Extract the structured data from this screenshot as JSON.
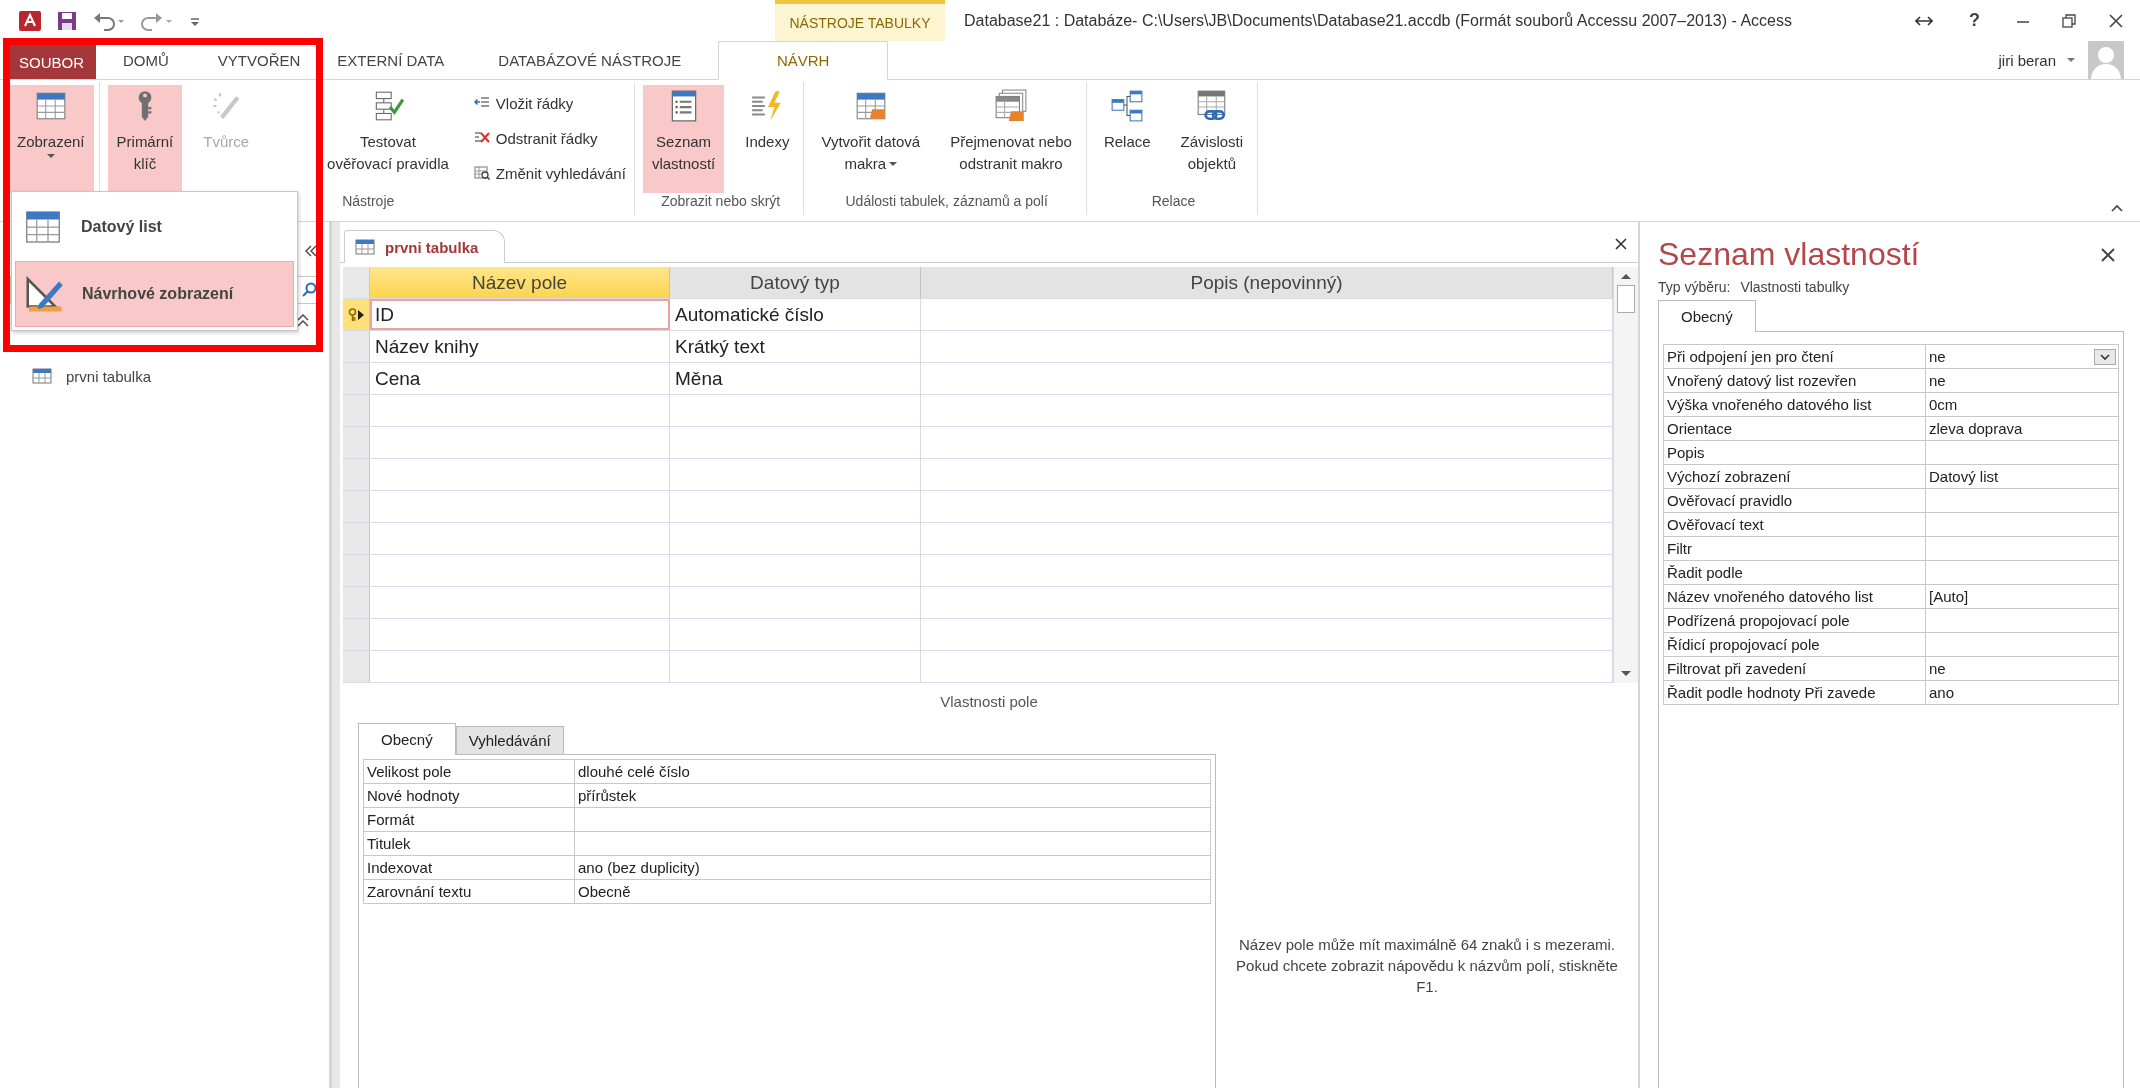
{
  "window": {
    "title": "Database21 : Databáze- C:\\Users\\JB\\Documents\\Database21.accdb (Formát souborů Accessu 2007–2013) - Access",
    "contextual_group": "NÁSTROJE TABULKY",
    "help_button": "?"
  },
  "user": {
    "name": "jiri beran"
  },
  "ribbon_tabs": [
    {
      "label": "SOUBOR",
      "kind": "file",
      "selected": false
    },
    {
      "label": "DOMŮ",
      "kind": "tab",
      "selected": false
    },
    {
      "label": "VYTVOŘEN",
      "kind": "tab",
      "selected": false
    },
    {
      "label": "EXTERNÍ DATA",
      "kind": "tab",
      "selected": false
    },
    {
      "label": "DATABÁZOVÉ NÁSTROJE",
      "kind": "tab",
      "selected": false
    },
    {
      "label": "NÁVRH",
      "kind": "tab",
      "selected": true
    }
  ],
  "ribbon_groups": [
    {
      "items": [
        {
          "kind": "large",
          "lines": [
            "Zobrazení"
          ],
          "pressed": true,
          "disabled": false,
          "dropdown": true
        }
      ]
    },
    {
      "label": "Nástroje",
      "items": [
        {
          "kind": "large",
          "lines": [
            "Primární",
            "klíč"
          ],
          "pressed": true,
          "disabled": false,
          "dropdown": false
        },
        {
          "kind": "large",
          "lines": [
            "Tvůrce"
          ],
          "pressed": false,
          "disabled": true,
          "dropdown": false
        },
        {
          "kind": "large",
          "lines": [
            "Testovat",
            "ověřovací pravidla"
          ],
          "pressed": false,
          "disabled": false,
          "dropdown": false
        },
        {
          "kind": "stack",
          "buttons": [
            {
              "label": "Vložit řádky"
            },
            {
              "label": "Odstranit řádky"
            },
            {
              "label": "Změnit vyhledávání"
            }
          ]
        }
      ]
    },
    {
      "label": "Zobrazit nebo skrýt",
      "items": [
        {
          "kind": "large",
          "lines": [
            "Seznam",
            "vlastností"
          ],
          "pressed": true,
          "disabled": false,
          "dropdown": false
        },
        {
          "kind": "large",
          "lines": [
            "Indexy"
          ],
          "pressed": false,
          "disabled": false,
          "dropdown": false
        }
      ]
    },
    {
      "label": "Události tabulek, záznamů a polí",
      "items": [
        {
          "kind": "large",
          "lines": [
            "Vytvořit datová",
            "makra"
          ],
          "pressed": false,
          "disabled": false,
          "dropdown": true
        },
        {
          "kind": "large",
          "lines": [
            "Přejmenovat nebo",
            "odstranit makro"
          ],
          "pressed": false,
          "disabled": false,
          "dropdown": false
        }
      ]
    },
    {
      "label": "Relace",
      "items": [
        {
          "kind": "large",
          "lines": [
            "Relace"
          ],
          "pressed": false,
          "disabled": false,
          "dropdown": false
        },
        {
          "kind": "large",
          "lines": [
            "Závislosti",
            "objektů"
          ],
          "pressed": false,
          "disabled": false,
          "dropdown": false
        }
      ]
    }
  ],
  "view_menu": {
    "items": [
      {
        "label": "Datový list",
        "selected": false
      },
      {
        "label": "Návrhové zobrazení",
        "selected": true
      }
    ]
  },
  "navigation_pane": {
    "items": [
      {
        "label": "prvni tabulka"
      }
    ]
  },
  "document_tab": {
    "label": "prvni tabulka"
  },
  "design_grid": {
    "columns": [
      {
        "label": "Název pole",
        "selected": true
      },
      {
        "label": "Datový typ",
        "selected": false
      },
      {
        "label": "Popis (nepovinný)",
        "selected": false
      }
    ],
    "rows": [
      {
        "name": "ID",
        "type": "Automatické číslo",
        "primary_key": true,
        "selected": true
      },
      {
        "name": "Název knihy",
        "type": "Krátký text",
        "primary_key": false,
        "selected": false
      },
      {
        "name": "Cena",
        "type": "Měna",
        "primary_key": false,
        "selected": false
      }
    ]
  },
  "field_properties": {
    "title": "Vlastnosti pole",
    "tabs": [
      {
        "label": "Obecný",
        "selected": true
      },
      {
        "label": "Vyhledávání",
        "selected": false
      }
    ],
    "rows": [
      {
        "label": "Velikost pole",
        "value": "dlouhé celé číslo"
      },
      {
        "label": "Nové hodnoty",
        "value": "přírůstek"
      },
      {
        "label": "Formát"
      },
      {
        "label": "Titulek"
      },
      {
        "label": "Indexovat",
        "value": "ano (bez duplicity)"
      },
      {
        "label": "Zarovnání textu",
        "value": "Obecně"
      }
    ],
    "help": "Název pole může mít maximálně 64 znaků i s mezerami. Pokud chcete zobrazit nápovědu k názvům polí, stiskněte F1."
  },
  "property_sheet": {
    "title": "Seznam vlastností",
    "selection_type_label": "Typ výběru:",
    "selection_type": "Vlastnosti tabulky",
    "tabs": [
      {
        "label": "Obecný",
        "selected": true
      }
    ],
    "rows": [
      {
        "label": "Při odpojení jen pro čtení",
        "value": "ne",
        "dropdown": true
      },
      {
        "label": "Vnořený datový list rozevřen",
        "value": "ne",
        "dropdown": false
      },
      {
        "label": "Výška vnořeného datového list",
        "value": "0cm",
        "dropdown": false
      },
      {
        "label": "Orientace",
        "value": "zleva doprava",
        "dropdown": false
      },
      {
        "label": "Popis",
        "dropdown": false
      },
      {
        "label": "Výchozí zobrazení",
        "value": "Datový list",
        "dropdown": false
      },
      {
        "label": "Ověřovací pravidlo",
        "dropdown": false
      },
      {
        "label": "Ověřovací text",
        "dropdown": false
      },
      {
        "label": "Filtr",
        "dropdown": false
      },
      {
        "label": "Řadit podle",
        "dropdown": false
      },
      {
        "label": "Název vnořeného datového list",
        "value": "[Auto]",
        "dropdown": false
      },
      {
        "label": "Podřízená propojovací pole",
        "dropdown": false
      },
      {
        "label": "Řídicí propojovací pole",
        "dropdown": false
      },
      {
        "label": "Filtrovat při zavedení",
        "value": "ne",
        "dropdown": false
      },
      {
        "label": "Řadit podle hodnoty Při zavede",
        "value": "ano",
        "dropdown": false
      }
    ]
  }
}
